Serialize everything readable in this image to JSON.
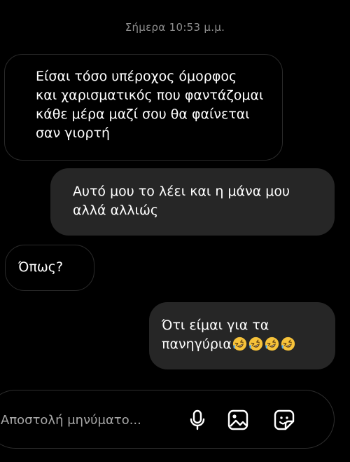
{
  "thread": {
    "timestamp": "Σήμερα 10:53 μ.μ.",
    "messages": [
      {
        "direction": "incoming",
        "lines": [
          "Είσαι τόσο υπέροχος όμορφος",
          "και χαρισματικός που φαντάζομαι",
          "κάθε μέρα μαζί σου θα φαίνεται",
          "σαν γιορτή"
        ]
      },
      {
        "direction": "outgoing",
        "lines": [
          "Αυτό μου το λέει και η μάνα μου",
          "αλλά αλλιώς"
        ]
      },
      {
        "direction": "incoming",
        "lines": [
          "Όπως?"
        ]
      },
      {
        "direction": "outgoing",
        "lines": [
          "Ότι είμαι για τα",
          "πανηγύρια"
        ],
        "emoji": "rolling-on-floor-laughing",
        "emoji_count": 4
      }
    ]
  },
  "composer": {
    "placeholder": "Αποστολή μηνύματο...",
    "icons": [
      "microphone-icon",
      "gallery-icon",
      "sticker-icon"
    ]
  },
  "colors": {
    "background": "#000000",
    "outgoing_bubble": "#262626",
    "incoming_border": "#2a2a2a",
    "accent": "#3f7be9",
    "emoji_yellow": "#f6c23a"
  }
}
